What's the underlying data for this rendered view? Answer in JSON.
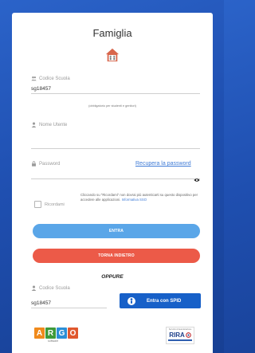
{
  "header": {
    "title": "Famiglia"
  },
  "login": {
    "school_code_label": "Codice Scuola",
    "school_code_value": "sg18457",
    "school_code_hint": "(obbligatorio per studenti e genitori)",
    "username_label": "Nome Utente",
    "password_label": "Password",
    "recover_password": "Recupera la password",
    "remember_label": "Ricordami",
    "remember_notice": "Cliccando su \"Ricordami\" non dovrai più autenticarti su questo dispositivo per accedere alle applicazioni.",
    "remember_notice_link": "Informativa SSO",
    "enter_button": "ENTRA",
    "back_button": "TORNA INDIETRO"
  },
  "alt": {
    "divider": "OPPURE",
    "school_code_label": "Codice Scuola",
    "school_code_value": "sg18457",
    "spid_button": "Entra con SPID"
  },
  "footer": {
    "argo_letters": [
      "A",
      "R",
      "G",
      "O"
    ],
    "argo_colors": [
      "#f08a1c",
      "#3f9a3a",
      "#2c8fd6",
      "#e0582e"
    ],
    "argo_sub": "software",
    "rira_top": "Servizio di Autenticazione",
    "rira_logo": "RIRA"
  },
  "colors": {
    "background": "#1f4fb0",
    "enter_button": "#5aa6e8",
    "back_button": "#ec5a48",
    "spid_button": "#1760c8",
    "link": "#3f7bd6"
  }
}
